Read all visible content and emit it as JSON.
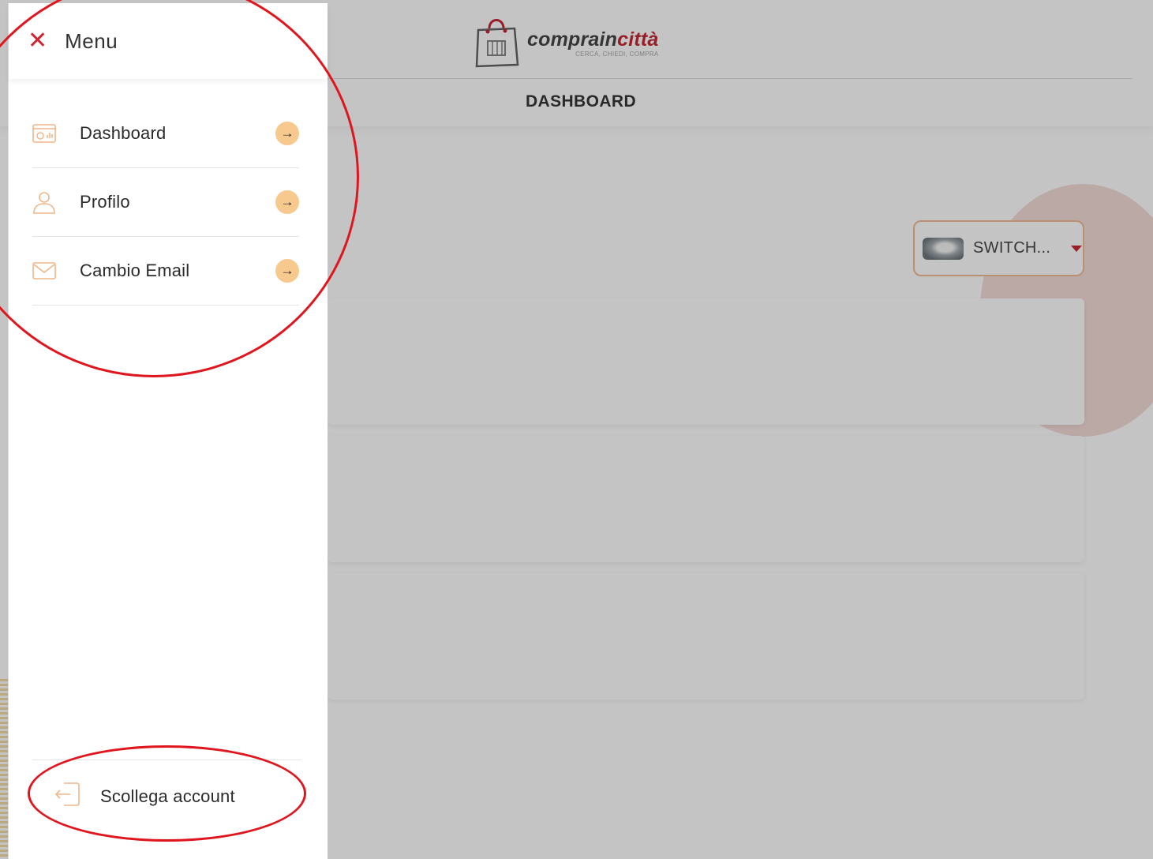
{
  "header": {
    "brand_main": "comprain",
    "brand_accent": "città",
    "tagline": "CERCA, CHIEDI, COMPRA",
    "page_title": "DASHBOARD",
    "logo_icon": "shopping-bag-icon"
  },
  "switch": {
    "label": "SWITCH...",
    "caret_icon": "caret-down-icon"
  },
  "drawer": {
    "close_icon": "close-icon",
    "title": "Menu",
    "items": [
      {
        "label": "Dashboard",
        "icon": "dashboard-icon",
        "arrow_icon": "arrow-right-icon"
      },
      {
        "label": "Profilo",
        "icon": "user-icon",
        "arrow_icon": "arrow-right-icon"
      },
      {
        "label": "Cambio Email",
        "icon": "envelope-icon",
        "arrow_icon": "arrow-right-icon"
      }
    ],
    "logout_label": "Scollega account",
    "logout_icon": "logout-icon"
  },
  "colors": {
    "accent_red": "#c0111f",
    "arrow_bg": "#f8c98e",
    "icon_orange": "#f0b68a",
    "annotation_red": "#e0161e"
  }
}
